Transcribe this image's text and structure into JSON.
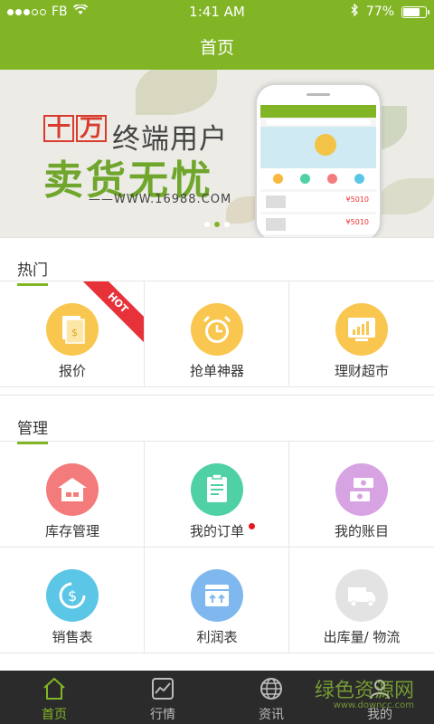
{
  "status_bar": {
    "carrier": "FB",
    "time": "1:41 AM",
    "battery": "77%",
    "battery_level": 0.77
  },
  "nav": {
    "title": "首页"
  },
  "banner": {
    "badge_chars": [
      "十",
      "万"
    ],
    "line1": "终端用户",
    "line2": "卖货无忧",
    "url": "——WWW.16988.COM",
    "phone_price_1": "¥5010",
    "phone_price_2": "¥5010",
    "page_index": 1,
    "page_count": 3
  },
  "sections": {
    "hot": {
      "title": "热门",
      "hot_badge": "HOT",
      "items": [
        {
          "label": "报价",
          "icon": "quote-document-icon",
          "color": "#f9c74f"
        },
        {
          "label": "抢单神器",
          "icon": "alarm-clock-icon",
          "color": "#f9c74f"
        },
        {
          "label": "理财超市",
          "icon": "chart-board-icon",
          "color": "#f9c74f"
        }
      ]
    },
    "manage": {
      "title": "管理",
      "items": [
        {
          "label": "库存管理",
          "icon": "warehouse-icon",
          "color": "#f47b7b"
        },
        {
          "label": "我的订单",
          "icon": "order-clipboard-icon",
          "color": "#4fd1a5"
        },
        {
          "label": "我的账目",
          "icon": "money-account-icon",
          "color": "#d7a3e3"
        },
        {
          "label": "销售表",
          "icon": "dollar-cycle-icon",
          "color": "#5bc6e6"
        },
        {
          "label": "利润表",
          "icon": "profit-box-icon",
          "color": "#7fb8ee"
        },
        {
          "label": "出库量/ 物流",
          "icon": "delivery-truck-icon",
          "color": "#e3e3e3"
        }
      ]
    }
  },
  "tabbar": {
    "items": [
      {
        "label": "首页",
        "icon": "home-icon",
        "active": true
      },
      {
        "label": "行情",
        "icon": "market-chart-icon",
        "active": false
      },
      {
        "label": "资讯",
        "icon": "globe-icon",
        "active": false
      },
      {
        "label": "我的",
        "icon": "user-icon",
        "active": false
      }
    ]
  },
  "watermark": {
    "text": "绿色资源网",
    "url": "www.downcc.com"
  },
  "colors": {
    "brand": "#82b526",
    "tabbar_bg": "#2b2b2b",
    "hot_red": "#e8323a"
  }
}
